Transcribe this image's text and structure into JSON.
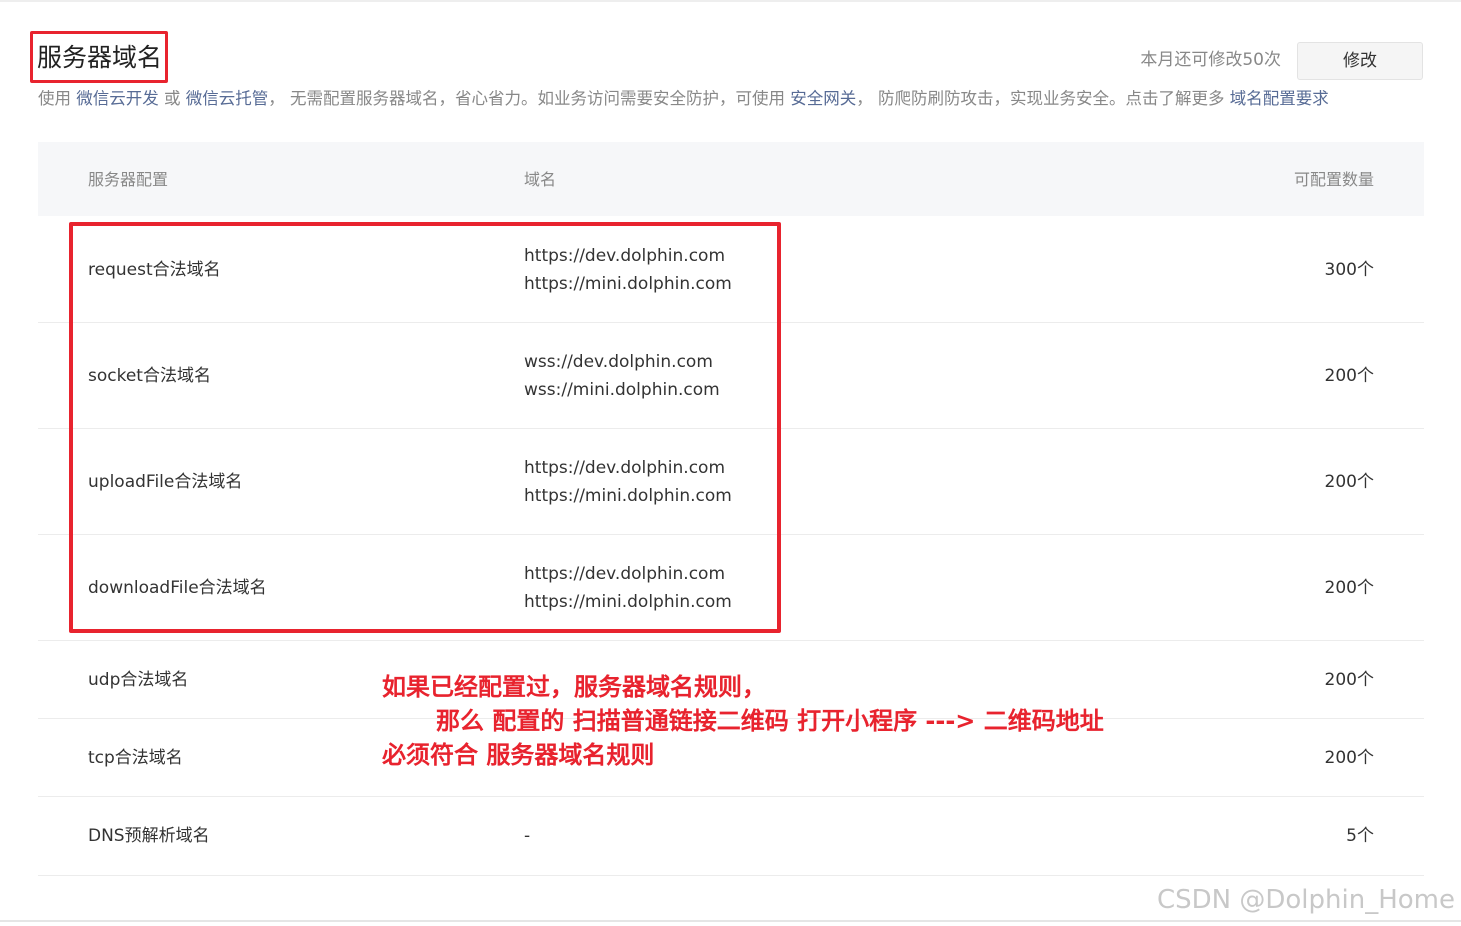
{
  "header": {
    "title": "服务器域名",
    "quota_text": "本月还可修改50次",
    "modify_button_label": "修改"
  },
  "description": {
    "part1": "使用 ",
    "link1": "微信云开发",
    "part2": " 或 ",
    "link2": "微信云托管",
    "part3": "， 无需配置服务器域名，省心省力。如业务访问需要安全防护，可使用 ",
    "link3": "安全网关",
    "part4": "， 防爬防刷防攻击，实现业务安全。点击了解更多 ",
    "link4": "域名配置要求"
  },
  "table": {
    "headers": {
      "config": "服务器配置",
      "domain": "域名",
      "count": "可配置数量"
    },
    "rows": [
      {
        "name": "request合法域名",
        "domains": [
          "https://dev.dolphin.com",
          "https://mini.dolphin.com"
        ],
        "count": "300个"
      },
      {
        "name": "socket合法域名",
        "domains": [
          "wss://dev.dolphin.com",
          "wss://mini.dolphin.com"
        ],
        "count": "200个"
      },
      {
        "name": "uploadFile合法域名",
        "domains": [
          "https://dev.dolphin.com",
          "https://mini.dolphin.com"
        ],
        "count": "200个"
      },
      {
        "name": "downloadFile合法域名",
        "domains": [
          "https://dev.dolphin.com",
          "https://mini.dolphin.com"
        ],
        "count": "200个"
      },
      {
        "name": "udp合法域名",
        "domains": [],
        "count": "200个"
      },
      {
        "name": "tcp合法域名",
        "domains": [],
        "count": "200个"
      },
      {
        "name": "DNS预解析域名",
        "domains": [
          "-"
        ],
        "count": "5个"
      }
    ]
  },
  "annotation": {
    "line1": "如果已经配置过，服务器域名规则，",
    "line2": "那么 配置的 扫描普通链接二维码 打开小程序 ---> 二维码地址",
    "line3": "必须符合 服务器域名规则"
  },
  "watermark": "CSDN @Dolphin_Home",
  "colors": {
    "annotation_red": "#e8232e",
    "link_blue": "#576b95",
    "header_bg": "#f6f7f9"
  }
}
